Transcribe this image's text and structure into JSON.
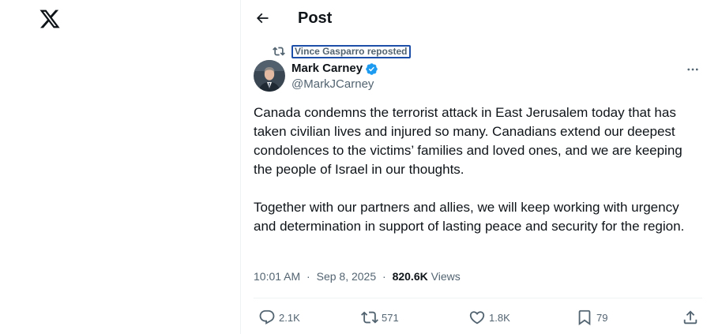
{
  "header": {
    "title": "Post"
  },
  "repost": {
    "text": "Vince Gasparro reposted"
  },
  "author": {
    "name": "Mark Carney",
    "handle": "@MarkJCarney"
  },
  "tweet": {
    "paragraphs": [
      "Canada condemns the terrorist attack in East Jerusalem today that has taken civilian lives and injured so many. Canadians extend our deepest condolences to the victims’ families and loved ones, and we are keeping the people of Israel in our thoughts.",
      "Together with our partners and allies, we will keep working with urgency and determination in support of lasting peace and security for the region."
    ]
  },
  "meta": {
    "time": "10:01 AM",
    "separator": "·",
    "date": "Sep 8, 2025",
    "views_count": "820.6K",
    "views_label": "Views"
  },
  "actions": {
    "replies": "2.1K",
    "reposts": "571",
    "likes": "1.8K",
    "bookmarks": "79"
  },
  "icons": {
    "logo": "x-logo-icon",
    "back": "arrow-left-icon",
    "repost": "repost-icon",
    "verified": "verified-badge-icon",
    "more": "more-horizontal-icon",
    "reply": "reply-icon",
    "like": "heart-icon",
    "bookmark": "bookmark-icon",
    "share": "share-icon"
  },
  "colors": {
    "verified": "#1d9bf0",
    "secondary_text": "#536471",
    "primary_text": "#0f1419",
    "focus_ring": "#1d4fa8"
  }
}
